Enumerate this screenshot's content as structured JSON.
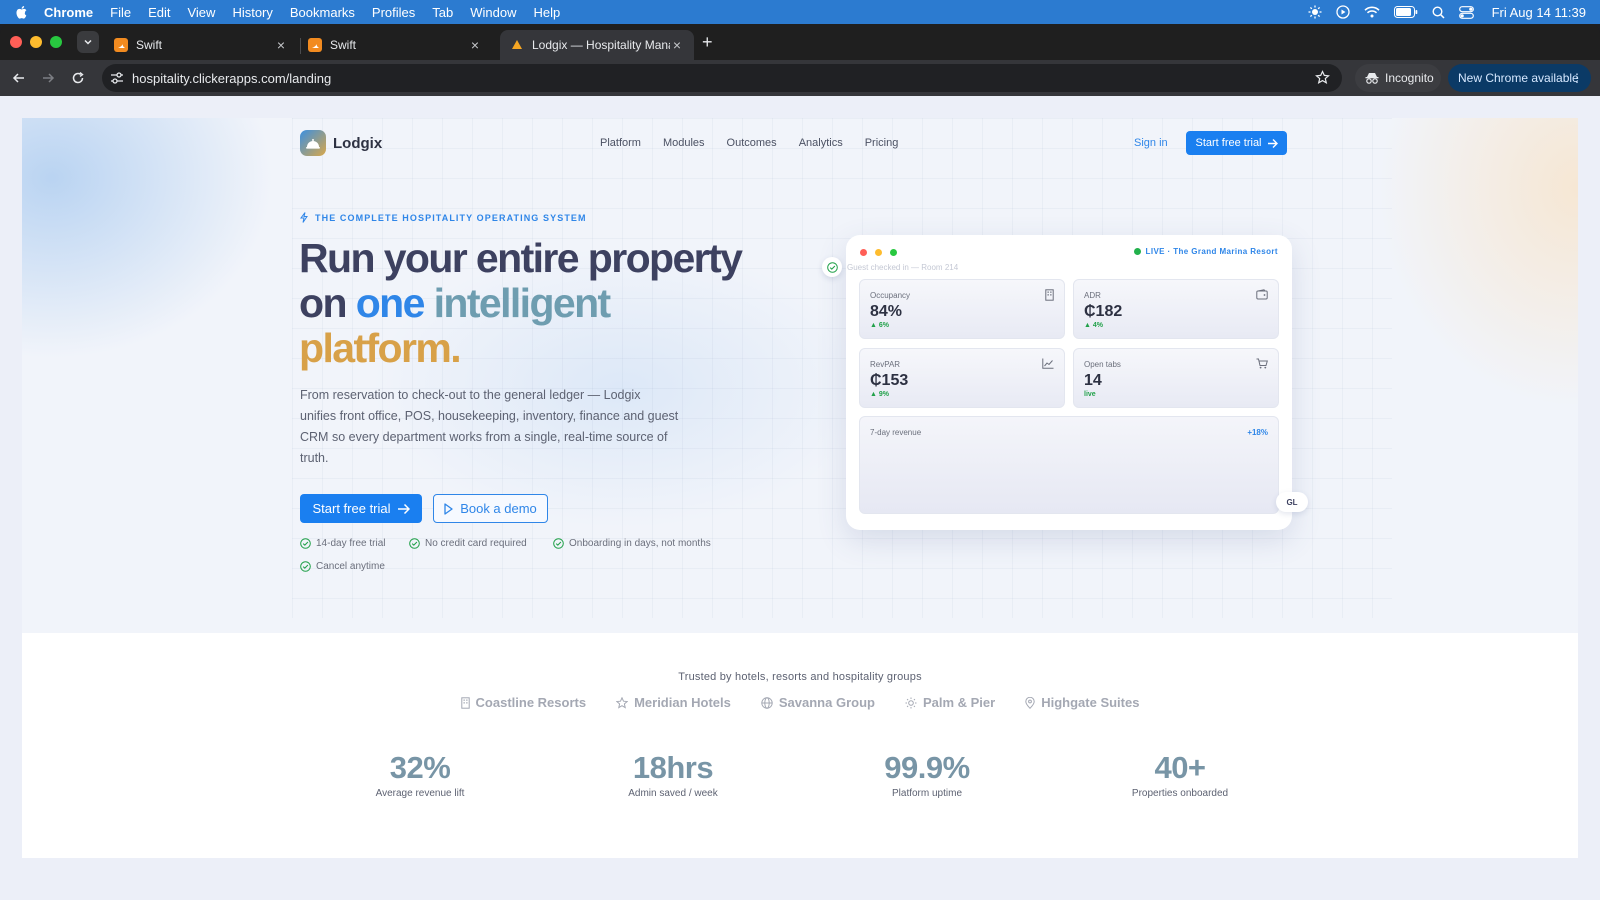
{
  "menubar": {
    "app": "Chrome",
    "items": [
      "File",
      "Edit",
      "View",
      "History",
      "Bookmarks",
      "Profiles",
      "Tab",
      "Window",
      "Help"
    ],
    "clock": "Fri Aug 14  11:39"
  },
  "browser": {
    "tabs": [
      {
        "title": "Swift",
        "active": false
      },
      {
        "title": "Swift",
        "active": false
      },
      {
        "title": "Lodgix — Hospitality Manager",
        "active": true
      }
    ],
    "url": "hospitality.clickerapps.com/landing",
    "incognito_label": "Incognito",
    "update_label": "New Chrome available"
  },
  "site": {
    "brand": "Lodgix",
    "nav": [
      "Platform",
      "Modules",
      "Outcomes",
      "Analytics",
      "Pricing"
    ],
    "signin": "Sign in",
    "trial_button": "Start free trial"
  },
  "hero": {
    "eyebrow": "THE COMPLETE HOSPITALITY OPERATING SYSTEM",
    "headline": {
      "line1": "Run your entire property",
      "on": "on ",
      "one": "one ",
      "intelligent": "intelligent",
      "platform": "platform."
    },
    "lede": "From reservation to check-out to the general ledger — Lodgix unifies front office, POS, housekeeping, inventory, finance and guest CRM so every department works from a single, real-time source of truth.",
    "cta_primary": "Start free trial",
    "cta_secondary": "Book a demo",
    "perks": [
      "14-day free trial",
      "No credit card required",
      "Onboarding in days, not months",
      "Cancel anytime"
    ]
  },
  "dashboard": {
    "live": "LIVE · The Grand Marina Resort",
    "ghost_note": "Guest checked in — Room 214",
    "kpis": [
      {
        "label": "Occupancy",
        "value": "84%",
        "delta": "▲ 6%",
        "icon": "building-icon"
      },
      {
        "label": "ADR",
        "value": "₵182",
        "delta": "▲ 4%",
        "icon": "wallet-icon"
      },
      {
        "label": "RevPAR",
        "value": "₵153",
        "delta": "▲ 9%",
        "icon": "chart-line-icon"
      },
      {
        "label": "Open tabs",
        "value": "14",
        "delta": "live",
        "icon": "cart-icon"
      }
    ],
    "revenue": {
      "label": "7-day revenue",
      "delta": "+18%"
    },
    "gl_chip": "GL"
  },
  "trust": {
    "title": "Trusted by hotels, resorts and hospitality groups",
    "brands": [
      {
        "name": "Coastline Resorts",
        "icon": "building-icon"
      },
      {
        "name": "Meridian Hotels",
        "icon": "star-icon"
      },
      {
        "name": "Savanna Group",
        "icon": "globe-icon"
      },
      {
        "name": "Palm & Pier",
        "icon": "sun-icon"
      },
      {
        "name": "Highgate Suites",
        "icon": "pin-icon"
      }
    ],
    "stats": [
      {
        "value": "32%",
        "label": "Average revenue lift"
      },
      {
        "value": "18hrs",
        "label": "Admin saved / week"
      },
      {
        "value": "99.9%",
        "label": "Platform uptime"
      },
      {
        "value": "40+",
        "label": "Properties onboarded"
      }
    ]
  },
  "colors": {
    "accent": "#1a7ff0",
    "headline": "#3d4160",
    "blue": "#2f86e8",
    "teal": "#6e9db0",
    "gold": "#d8a148",
    "success": "#22a14a"
  }
}
